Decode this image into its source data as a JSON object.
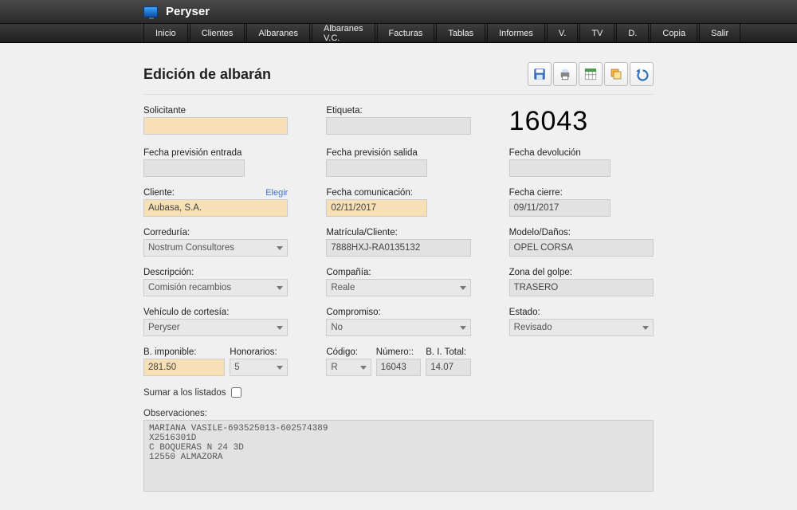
{
  "app": {
    "title": "Peryser"
  },
  "menu": [
    "Inicio",
    "Clientes",
    "Albaranes",
    "Albaranes V.C.",
    "Facturas",
    "Tablas",
    "Informes",
    "V.",
    "TV",
    "D.",
    "Copia",
    "Salir"
  ],
  "page_title": "Edición de albarán",
  "big_number": "16043",
  "labels": {
    "solicitante": "Solicitante",
    "etiqueta": "Etiqueta:",
    "f_prev_entrada": "Fecha previsión entrada",
    "f_prev_salida": "Fecha previsión salida",
    "f_devolucion": "Fecha devolución",
    "cliente": "Cliente:",
    "elegir": "Elegir",
    "f_comunicacion": "Fecha comunicación:",
    "f_cierre": "Fecha cierre:",
    "correduria": "Correduría:",
    "matricula": "Matrícula/Cliente:",
    "modelo": "Modelo/Daños:",
    "descripcion": "Descripción:",
    "compania": "Compañía:",
    "zona_golpe": "Zona del golpe:",
    "veh_cortesia": "Vehículo de cortesía:",
    "compromiso": "Compromiso:",
    "estado": "Estado:",
    "b_imponible": "B. imponible:",
    "honorarios": "Honorarios:",
    "codigo": "Código:",
    "numero": "Número::",
    "bi_total": "B. I. Total:",
    "sumar": "Sumar a los listados",
    "observaciones": "Observaciones:"
  },
  "values": {
    "solicitante": "",
    "etiqueta": "",
    "f_prev_entrada": "",
    "f_prev_salida": "",
    "f_devolucion": "",
    "cliente": "Aubasa, S.A.",
    "f_comunicacion": "02/11/2017",
    "f_cierre": "09/11/2017",
    "correduria": "Nostrum Consultores",
    "matricula": "7888HXJ-RA0135132",
    "modelo": "OPEL CORSA",
    "descripcion": "Comisión recambios",
    "compania": "Reale",
    "zona_golpe": "TRASERO",
    "veh_cortesia": "Peryser",
    "compromiso": "No",
    "estado": "Revisado",
    "b_imponible": "281.50",
    "honorarios": "5",
    "codigo": "R",
    "numero": "16043",
    "bi_total": "14.07",
    "observaciones": "MARIANA VASILE-693525013-602574389\nX2516301D\nC BOQUERAS N 24 3D\n12550 ALMAZORA"
  },
  "toolbar_names": [
    "save",
    "print",
    "grid",
    "windows",
    "undo"
  ]
}
